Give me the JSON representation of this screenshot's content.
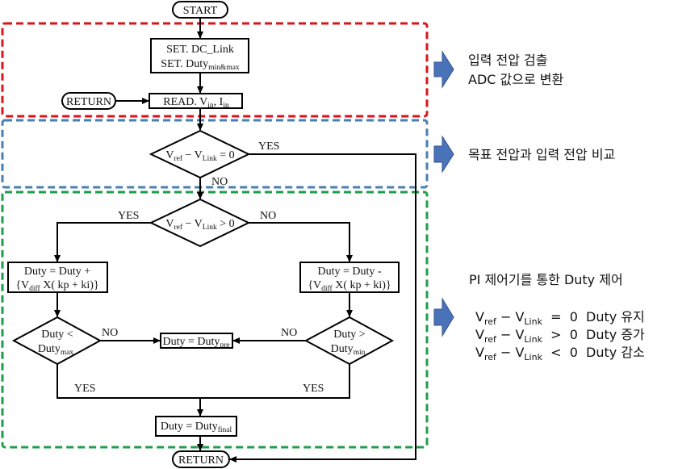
{
  "colors": {
    "region_input": "#d9141c",
    "region_compare": "#4a7fb0",
    "region_control": "#1e9e4a",
    "arrow_fill": "#4a72b8",
    "arrow_stroke": "#34558f",
    "line": "#000000"
  },
  "flowchart": {
    "start": "START",
    "set_box": {
      "line1": "SET. DC_Link",
      "line2_main": "SET. Duty",
      "line2_sub": "min&max"
    },
    "return_left": "RETURN",
    "read_box": {
      "main": "READ. V",
      "sub1": "in",
      "mid": ", I",
      "sub2": "in"
    },
    "decision_equal": {
      "v1": "V",
      "s1": "ref",
      "op": " − V",
      "s2": "Link",
      "tail": " = 0",
      "yes": "YES",
      "no": "NO"
    },
    "decision_greater": {
      "v1": "V",
      "s1": "ref",
      "op": " − V",
      "s2": "Link",
      "tail": " > 0",
      "yes": "YES",
      "no": "NO"
    },
    "increase_box": {
      "line1": "Duty = Duty +",
      "line2_a": "{V",
      "line2_sub": "diff",
      "line2_b": " X( kp + ki)}"
    },
    "decrease_box": {
      "line1": "Duty = Duty -",
      "line2_a": "{V",
      "line2_sub": "diff",
      "line2_b": " X( kp + ki)}"
    },
    "decision_max": {
      "line1": "Duty <",
      "line2": "Duty",
      "line2_sub": "max",
      "no": "NO",
      "yes": "YES"
    },
    "decision_min": {
      "line1": "Duty >",
      "line2": "Duty",
      "line2_sub": "min",
      "no": "NO",
      "yes": "YES"
    },
    "prev_box": {
      "main": "Duty = Duty",
      "sub": "pre"
    },
    "final_box": {
      "main": "Duty = Duty",
      "sub": "final"
    },
    "return_end": "RETURN"
  },
  "annotations": {
    "input": {
      "line1": "입력 전압 검출",
      "line2": "ADC 값으로 변환"
    },
    "compare": {
      "line1": "목표 전압과 입력 전압 비교"
    },
    "control": {
      "title": "PI 제어기를 통한 Duty 제어",
      "rows": [
        {
          "v": "V",
          "s1": "ref",
          "op": " − V",
          "s2": "Link",
          "rel": "  =  0",
          "action": "Duty 유지"
        },
        {
          "v": "V",
          "s1": "ref",
          "op": " − V",
          "s2": "Link",
          "rel": "  >  0",
          "action": "Duty 증가"
        },
        {
          "v": "V",
          "s1": "ref",
          "op": " − V",
          "s2": "Link",
          "rel": "  <  0",
          "action": "Duty 감소"
        }
      ]
    }
  }
}
